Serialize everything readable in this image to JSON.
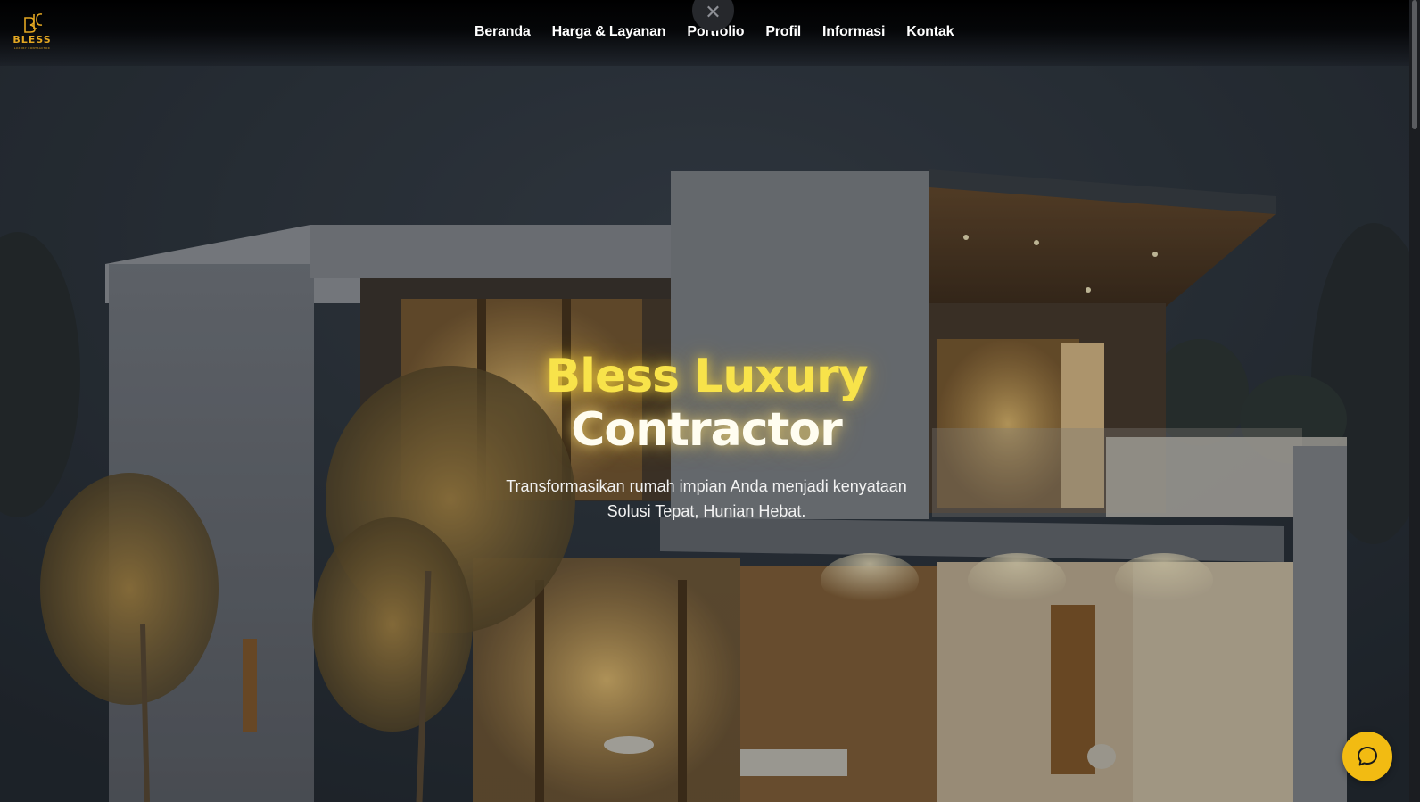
{
  "brand": {
    "name": "BLESS",
    "tagline": "LUXURY CONTRACTOR",
    "monogram": "BLC",
    "accent_color": "#e3a722"
  },
  "nav": {
    "items": [
      {
        "label": "Beranda"
      },
      {
        "label": "Harga & Layanan"
      },
      {
        "label": "Portfolio"
      },
      {
        "label": "Profil"
      },
      {
        "label": "Informasi"
      },
      {
        "label": "Kontak"
      }
    ],
    "close_icon": "close-icon"
  },
  "hero": {
    "title_line1": "Bless Luxury",
    "title_line2": "Contractor",
    "subtitle_line1": "Transformasikan rumah impian Anda menjadi kenyataan",
    "subtitle_line2": "Solusi Tepat, Hunian Hebat.",
    "title_color": "#f8e34a",
    "background_image": "modern two-storey house at night"
  },
  "chat": {
    "icon": "chat-bubble-icon",
    "color": "#f2bb12"
  }
}
